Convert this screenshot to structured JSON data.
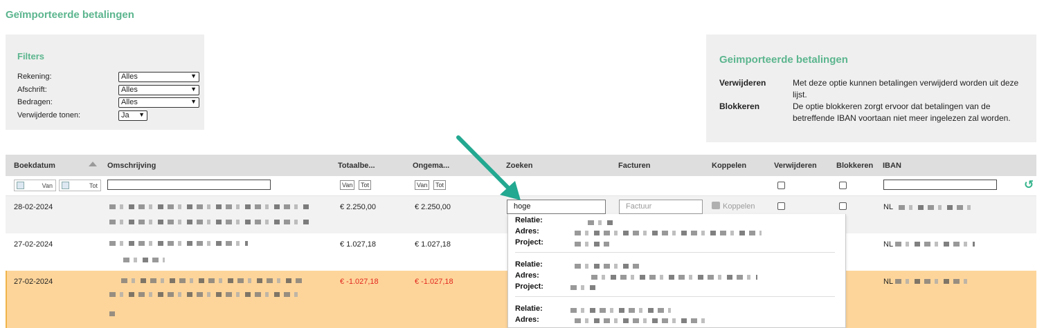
{
  "page_title": "Geïmporteerde betalingen",
  "filters": {
    "title": "Filters",
    "rows": [
      {
        "label": "Rekening:",
        "value": "Alles"
      },
      {
        "label": "Afschrift:",
        "value": "Alles"
      },
      {
        "label": "Bedragen:",
        "value": "Alles"
      },
      {
        "label": "Verwijderde tonen:",
        "value": "Ja"
      }
    ]
  },
  "info": {
    "title": "Geimporteerde betalingen",
    "items": [
      {
        "term": "Verwijderen",
        "desc": "Met deze optie kunnen betalingen verwijderd worden uit deze lijst."
      },
      {
        "term": "Blokkeren",
        "desc": "De optie blokkeren zorgt ervoor dat betalingen van de betreffende IBAN voortaan niet meer ingelezen zal worden."
      }
    ]
  },
  "table": {
    "headers": {
      "boekdatum": "Boekdatum",
      "omschrijving": "Omschrijving",
      "totaal": "Totaalbe...",
      "ongema": "Ongema...",
      "zoeken": "Zoeken",
      "facturen": "Facturen",
      "koppelen": "Koppelen",
      "verwijderen": "Verwijderen",
      "blokkeren": "Blokkeren",
      "iban": "IBAN"
    },
    "filter_row": {
      "van": "Van",
      "tot": "Tot"
    },
    "rows": [
      {
        "date": "28-02-2024",
        "total": "€ 2.250,00",
        "open": "€ 2.250,00",
        "iban_prefix": "NL"
      },
      {
        "date": "27-02-2024",
        "total": "€ 1.027,18",
        "open": "€ 1.027,18",
        "iban_prefix": "NL"
      },
      {
        "date": "27-02-2024",
        "total": "€ -1.027,18",
        "open": "€ -1.027,18",
        "iban_prefix": "NL"
      }
    ],
    "search_value": "hoge",
    "factuur_placeholder": "Factuur",
    "koppelen_label": "Koppelen"
  },
  "dropdown": {
    "labels": {
      "relatie": "Relatie:",
      "adres": "Adres:",
      "project": "Project:"
    }
  },
  "colors": {
    "accent": "#5bb58e",
    "highlight_row": "#fdd59b",
    "negative": "#e2261c",
    "arrow": "#23a891"
  }
}
